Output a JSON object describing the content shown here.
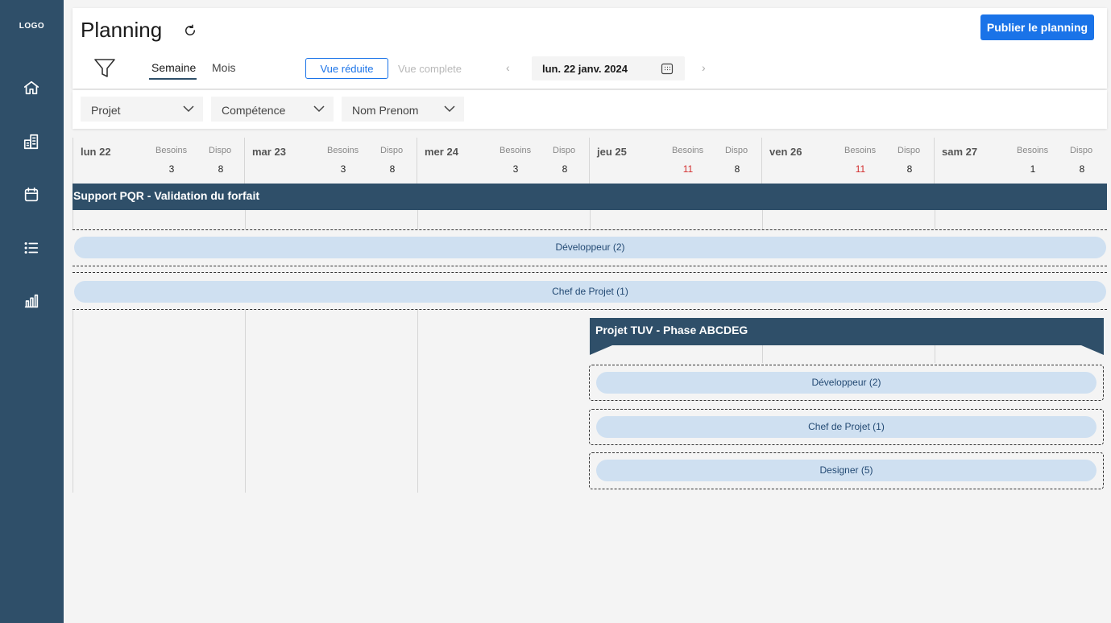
{
  "sidebar": {
    "logo": "LOGO",
    "items": [
      {
        "icon": "home-icon"
      },
      {
        "icon": "building-icon"
      },
      {
        "icon": "calendar-icon"
      },
      {
        "icon": "list-icon"
      },
      {
        "icon": "bar-chart-icon"
      }
    ]
  },
  "header": {
    "title": "Planning",
    "publish_label": "Publier le planning",
    "tabs": [
      "Semaine",
      "Mois"
    ],
    "active_tab": "Semaine",
    "view_reduced": "Vue réduite",
    "view_complete": "Vue complete",
    "date": "lun. 22 janv. 2024"
  },
  "filters": {
    "project": "Projet",
    "skill": "Compétence",
    "name": "Nom Prenom"
  },
  "calendar": {
    "col_needs": "Besoins",
    "col_avail": "Dispo",
    "days": [
      {
        "name": "lun 22",
        "needs": "3",
        "avail": "8",
        "needs_over": false
      },
      {
        "name": "mar 23",
        "needs": "3",
        "avail": "8",
        "needs_over": false
      },
      {
        "name": "mer 24",
        "needs": "3",
        "avail": "8",
        "needs_over": false
      },
      {
        "name": "jeu 25",
        "needs": "11",
        "avail": "8",
        "needs_over": true
      },
      {
        "name": "ven 26",
        "needs": "11",
        "avail": "8",
        "needs_over": true
      },
      {
        "name": "sam 27",
        "needs": "1",
        "avail": "8",
        "needs_over": false
      }
    ],
    "projects": [
      {
        "title": "Support PQR - Validation du forfait",
        "roles": [
          "Développeur (2)",
          "Chef de Projet (1)"
        ]
      },
      {
        "title": "Projet TUV - Phase ABCDEG",
        "roles": [
          "Développeur (2)",
          "Chef de Projet (1)",
          "Designer (5)"
        ]
      }
    ]
  },
  "colors": {
    "sidebar": "#2f4f69",
    "accent": "#1a73e8",
    "pill": "#cfe0f1",
    "over": "#d32f2f"
  }
}
